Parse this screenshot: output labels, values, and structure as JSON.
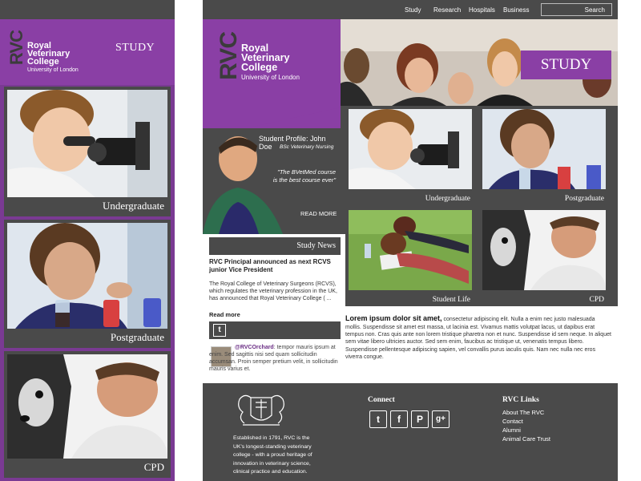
{
  "mobile": {
    "study_label": "STUDY",
    "logo": {
      "mark": "RVC",
      "name_lines": [
        "Royal",
        "Veterinary",
        "College"
      ],
      "subtitle": "University of London"
    },
    "cards": [
      {
        "caption": "Undergraduate",
        "image": "student-microscope-photo"
      },
      {
        "caption": "Postgraduate",
        "image": "researcher-test-tubes-photo"
      },
      {
        "caption": "CPD",
        "image": "vet-with-dog-photo"
      }
    ]
  },
  "desktop": {
    "nav": {
      "items": [
        "Study",
        "Research",
        "Hospitals",
        "Business"
      ],
      "search_label": "Search"
    },
    "logo": {
      "mark": "RVC",
      "name_lines": [
        "Royal",
        "Veterinary",
        "College"
      ],
      "subtitle": "University of London"
    },
    "hero_banner": "STUDY",
    "profile": {
      "title": "Student Profile: John Doe",
      "subtitle": "BSc Veterinary Nursing",
      "quote": "\"The BVetMed course is the best course ever\"",
      "read_more": "READ MORE"
    },
    "news": {
      "heading": "Study News",
      "headline": "RVC Principal announced as next RCVS junior Vice President",
      "body": "The Royal College of Veterinary Surgeons (RCVS), which regulates the veterinary profession in the UK, has announced that Royal Veterinary College ( ...",
      "read_more": "Read more"
    },
    "twitter": {
      "handle": "@RVCOrchard",
      "tweet": ": tempor mauris ipsum at enim. Sed sagittis nisi sed quam sollicitudin accumsan. Proin semper pretium velit, in sollicitudin mauris varius et."
    },
    "cards": [
      {
        "caption": "Undergraduate"
      },
      {
        "caption": "Postgraduate"
      },
      {
        "caption": "Student Life"
      },
      {
        "caption": "CPD"
      }
    ],
    "lorem": {
      "heading": "Lorem ipsum dolor sit amet,",
      "body": " consectetur adipiscing elit. Nulla a enim nec justo malesuada mollis. Suspendisse sit amet est massa, ut lacinia est. Vivamus mattis volutpat lacus, ut dapibus erat tempus non. Cras quis ante non lorem tristique pharetra non et nunc. Suspendisse id sem neque. In aliquet sem vitae libero ultricies auctor. Sed sem enim, faucibus ac tristique ut, venenatis tempus libero. Suspendisse pellentesque adipiscing sapien, vel convallis purus iaculis quis. Nam nec nulla nec eros viverra congue."
    },
    "footer": {
      "established": "Established in 1791, RVC is the UK's longest-standing veterinary college - with a proud heritage of innovation in veterinary science, clinical practice and education.",
      "connect_heading": "Connect",
      "social": [
        {
          "icon": "twitter-icon",
          "glyph": "t"
        },
        {
          "icon": "facebook-icon",
          "glyph": "f"
        },
        {
          "icon": "pinterest-icon",
          "glyph": "P"
        },
        {
          "icon": "googleplus-icon",
          "glyph": "g+"
        }
      ],
      "links_heading": "RVC Links",
      "links": [
        "About The RVC",
        "Contact",
        "Alumni",
        "Animal Care Trust"
      ]
    }
  },
  "colors": {
    "purple": "#8a3fa5",
    "dark_grey": "#4a4a4a",
    "mobile_bg": "#7a3a93"
  }
}
